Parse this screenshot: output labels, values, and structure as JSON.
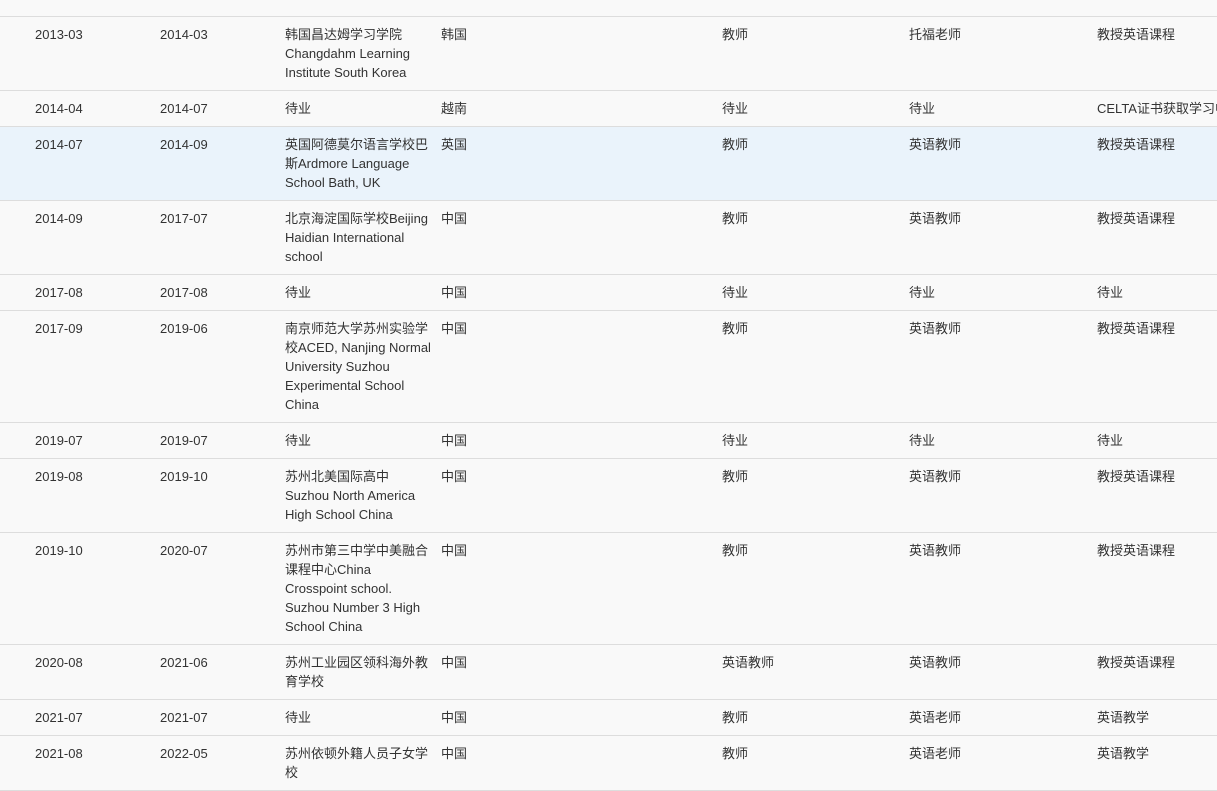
{
  "rows": [
    {
      "start": "",
      "end": "",
      "org": "South Korea",
      "country": "",
      "position": "",
      "title": "",
      "duty": ""
    },
    {
      "start": "2013-03",
      "end": "2014-03",
      "org": "韩国昌达姆学习学院Changdahm Learning Institute South Korea",
      "country": "韩国",
      "position": "教师",
      "title": "托福老师",
      "duty": "教授英语课程"
    },
    {
      "start": "2014-04",
      "end": "2014-07",
      "org": "待业",
      "country": "越南",
      "position": "待业",
      "title": "待业",
      "duty": "CELTA证书获取学习中"
    },
    {
      "start": "2014-07",
      "end": "2014-09",
      "org": "英国阿德莫尔语言学校巴斯Ardmore Language School Bath, UK",
      "country": "英国",
      "position": "教师",
      "title": "英语教师",
      "duty": "教授英语课程"
    },
    {
      "start": "2014-09",
      "end": "2017-07",
      "org": "北京海淀国际学校Beijing Haidian International school",
      "country": "中国",
      "position": "教师",
      "title": "英语教师",
      "duty": "教授英语课程"
    },
    {
      "start": "2017-08",
      "end": "2017-08",
      "org": "待业",
      "country": "中国",
      "position": "待业",
      "title": "待业",
      "duty": "待业"
    },
    {
      "start": "2017-09",
      "end": "2019-06",
      "org": "南京师范大学苏州实验学校ACED, Nanjing Normal University Suzhou Experimental School China",
      "country": "中国",
      "position": "教师",
      "title": "英语教师",
      "duty": "教授英语课程"
    },
    {
      "start": "2019-07",
      "end": "2019-07",
      "org": "待业",
      "country": "中国",
      "position": "待业",
      "title": "待业",
      "duty": "待业"
    },
    {
      "start": "2019-08",
      "end": "2019-10",
      "org": "苏州北美国际高中 Suzhou North America High School China",
      "country": "中国",
      "position": "教师",
      "title": "英语教师",
      "duty": "教授英语课程"
    },
    {
      "start": "2019-10",
      "end": "2020-07",
      "org": "苏州市第三中学中美融合课程中心China Crosspoint school. Suzhou Number 3 High School China",
      "country": "中国",
      "position": "教师",
      "title": "英语教师",
      "duty": "教授英语课程"
    },
    {
      "start": "2020-08",
      "end": "2021-06",
      "org": "苏州工业园区领科海外教育学校",
      "country": "中国",
      "position": "英语教师",
      "title": "英语教师",
      "duty": "教授英语课程"
    },
    {
      "start": "2021-07",
      "end": "2021-07",
      "org": "待业",
      "country": "中国",
      "position": "教师",
      "title": "英语老师",
      "duty": "英语教学"
    },
    {
      "start": "2021-08",
      "end": "2022-05",
      "org": "苏州依顿外籍人员子女学校",
      "country": "中国",
      "position": "教师",
      "title": "英语老师",
      "duty": "英语教学"
    }
  ]
}
